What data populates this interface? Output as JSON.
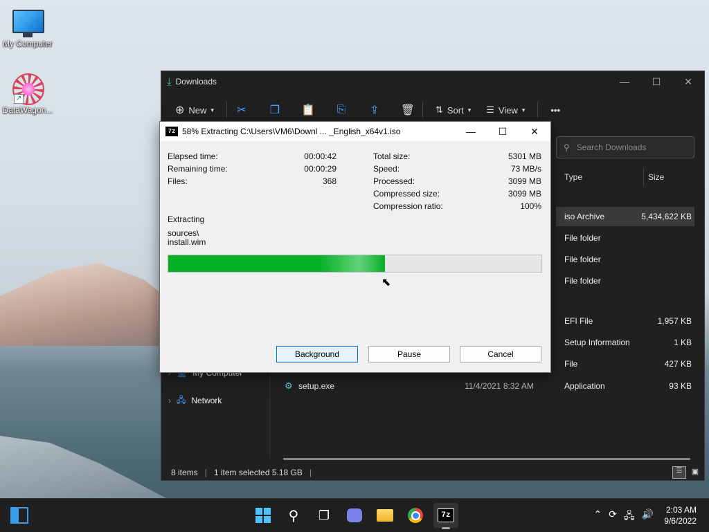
{
  "desktop": {
    "icons": [
      {
        "label": "My Computer",
        "icon": "monitor-icon"
      },
      {
        "label": "DataWagon...",
        "icon": "datawagon-icon"
      }
    ]
  },
  "explorer": {
    "title": "Downloads",
    "toolbar": {
      "new_label": "New",
      "sort_label": "Sort",
      "view_label": "View",
      "more_label": "•••"
    },
    "search_placeholder": "Search Downloads",
    "columns": {
      "type": "Type",
      "size": "Size"
    },
    "rows": [
      {
        "type": "iso Archive",
        "size": "5,434,622 KB"
      },
      {
        "type": "File folder",
        "size": ""
      },
      {
        "type": "File folder",
        "size": ""
      },
      {
        "type": "File folder",
        "size": ""
      },
      {
        "type": "EFI File",
        "size": "1,957 KB"
      },
      {
        "type": "Setup Information",
        "size": "1 KB"
      },
      {
        "type": "File",
        "size": "427 KB"
      },
      {
        "type": "Application",
        "size": "93 KB"
      }
    ],
    "visible_file": {
      "name": "setup.exe",
      "date": "11/4/2021 8:32 AM"
    },
    "nav": {
      "my_computer": "My Computer",
      "network": "Network"
    },
    "status": {
      "items": "8 items",
      "selected": "1 item selected  5.18 GB"
    }
  },
  "dialog": {
    "title": "58% Extracting C:\\Users\\VM6\\Downl ... _English_x64v1.iso",
    "left": [
      {
        "label": "Elapsed time:",
        "value": "00:00:42"
      },
      {
        "label": "Remaining time:",
        "value": "00:00:29"
      },
      {
        "label": "Files:",
        "value": "368"
      }
    ],
    "right": [
      {
        "label": "Total size:",
        "value": "5301 MB"
      },
      {
        "label": "Speed:",
        "value": "73 MB/s"
      },
      {
        "label": "Processed:",
        "value": "3099 MB"
      },
      {
        "label": "Compressed size:",
        "value": "3099 MB"
      },
      {
        "label": "Compression ratio:",
        "value": "100%"
      }
    ],
    "operation": "Extracting",
    "path_line1": "sources\\",
    "path_line2": "install.wim",
    "progress_percent": 58,
    "buttons": {
      "background": "Background",
      "pause": "Pause",
      "cancel": "Cancel"
    }
  },
  "taskbar": {
    "time": "2:03 AM",
    "date": "9/6/2022"
  }
}
